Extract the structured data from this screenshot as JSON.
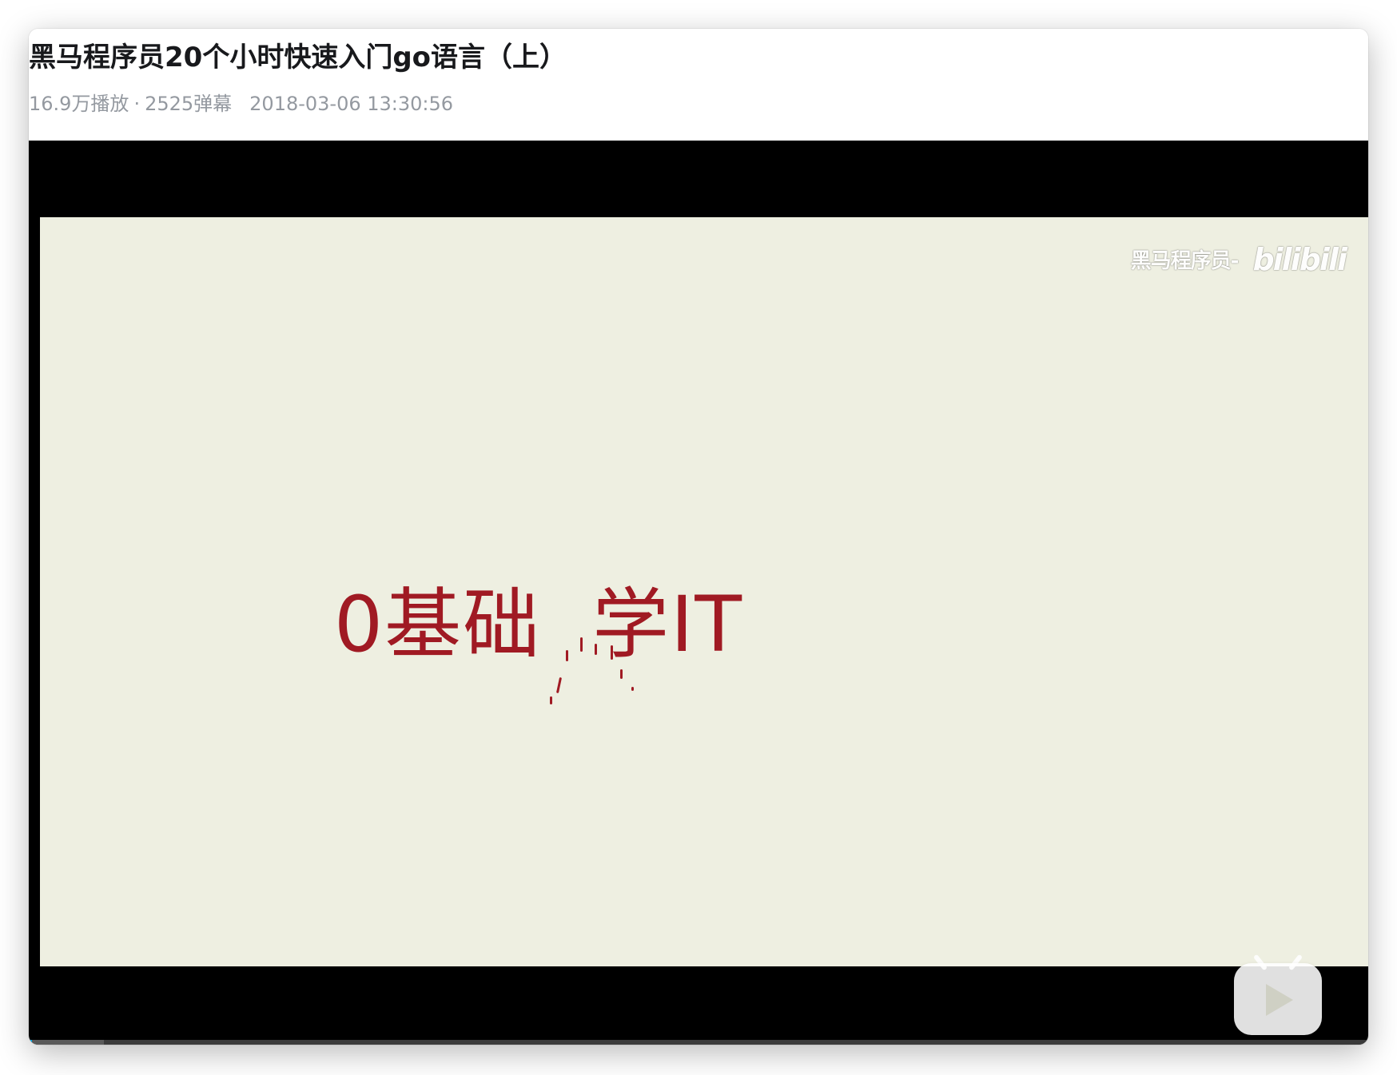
{
  "video": {
    "title": "黑马程序员20个小时快速入门go语言（上）",
    "views": "16.9万播放",
    "separator": "·",
    "danmaku": "2525弹幕",
    "pubdate": "2018-03-06 13:30:56"
  },
  "frame": {
    "watermark_text": "黑马程序员-",
    "watermark_logo": "bilibili",
    "headline_left": "0基础",
    "headline_right": "学IT",
    "background_color": "#eeefe1",
    "headline_color": "#a01a23"
  },
  "player": {
    "play_icon": "bilibili-tv-play-icon",
    "progress_fraction": 0.056,
    "progress_color": "#5a5a5a",
    "accent_color": "#00aeec"
  }
}
